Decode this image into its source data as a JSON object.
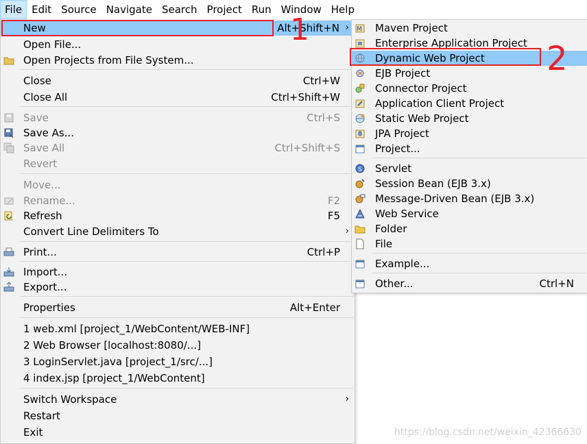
{
  "menubar": [
    "File",
    "Edit",
    "Source",
    "Navigate",
    "Search",
    "Project",
    "Run",
    "Window",
    "Help"
  ],
  "file_menu": {
    "new": {
      "label": "New",
      "accel": "Alt+Shift+N"
    },
    "open_file": {
      "label": "Open File..."
    },
    "open_projects": {
      "label": "Open Projects from File System..."
    },
    "close": {
      "label": "Close",
      "accel": "Ctrl+W"
    },
    "close_all": {
      "label": "Close All",
      "accel": "Ctrl+Shift+W"
    },
    "save": {
      "label": "Save",
      "accel": "Ctrl+S"
    },
    "save_as": {
      "label": "Save As..."
    },
    "save_all": {
      "label": "Save All",
      "accel": "Ctrl+Shift+S"
    },
    "revert": {
      "label": "Revert"
    },
    "move": {
      "label": "Move..."
    },
    "rename": {
      "label": "Rename...",
      "accel": "F2"
    },
    "refresh": {
      "label": "Refresh",
      "accel": "F5"
    },
    "convert": {
      "label": "Convert Line Delimiters To"
    },
    "print": {
      "label": "Print...",
      "accel": "Ctrl+P"
    },
    "import": {
      "label": "Import..."
    },
    "export": {
      "label": "Export..."
    },
    "properties": {
      "label": "Properties",
      "accel": "Alt+Enter"
    },
    "recent": [
      "1 web.xml  [project_1/WebContent/WEB-INF]",
      "2 Web Browser  [localhost:8080/...]",
      "3 LoginServlet.java  [project_1/src/...]",
      "4 index.jsp  [project_1/WebContent]"
    ],
    "switch_workspace": {
      "label": "Switch Workspace"
    },
    "restart": {
      "label": "Restart"
    },
    "exit": {
      "label": "Exit"
    }
  },
  "new_menu": {
    "items": [
      "Maven Project",
      "Enterprise Application Project",
      "Dynamic Web Project",
      "EJB Project",
      "Connector Project",
      "Application Client Project",
      "Static Web Project",
      "JPA Project",
      "Project...",
      "Servlet",
      "Session Bean (EJB 3.x)",
      "Message-Driven Bean (EJB 3.x)",
      "Web Service",
      "Folder",
      "File",
      "Example...",
      "Other..."
    ],
    "other_accel": "Ctrl+N"
  },
  "annotations": {
    "one": "1",
    "two": "2"
  },
  "watermark": "https://blog.csdn.net/weixin_42366630",
  "colors": {
    "highlight": "#91c9f7",
    "annotation": "#e8202a",
    "menu_bg": "#f2f2f2"
  }
}
